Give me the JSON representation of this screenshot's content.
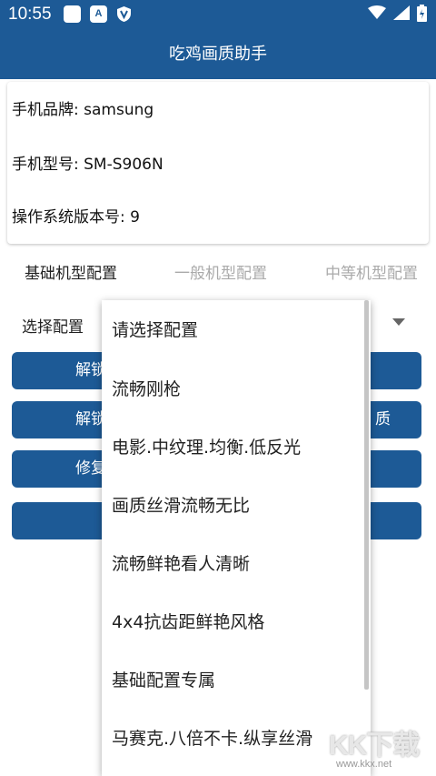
{
  "status_bar": {
    "time": "10:55",
    "icons": [
      "square-notification-icon",
      "a-notification-icon",
      "shield-notification-icon",
      "wifi-icon",
      "signal-icon",
      "battery-charging-icon"
    ],
    "a_icon_label": "A"
  },
  "app": {
    "title": "吃鸡画质助手"
  },
  "device_info": {
    "brand": "手机品牌: samsung",
    "model": "手机型号: SM-S906N",
    "os_version": "操作系统版本号: 9"
  },
  "tabs": [
    {
      "label": "基础机型配置",
      "active": true
    },
    {
      "label": "一般机型配置",
      "active": false
    },
    {
      "label": "中等机型配置",
      "active": false
    }
  ],
  "config_select": {
    "label": "选择配置"
  },
  "buttons": [
    {
      "label_visible": "解锁"
    },
    {
      "label_visible": "解锁",
      "label_tail_visible": "质"
    },
    {
      "label_visible": "修复"
    },
    {
      "label_visible": ""
    }
  ],
  "dropdown": {
    "options": [
      "请选择配置",
      "流畅刚枪",
      "电影.中纹理.均衡.低反光",
      "画质丝滑流畅无比",
      "流畅鲜艳看人清晰",
      "4x4抗齿距鲜艳风格",
      "基础配置专属",
      "马赛克.八倍不卡.纵享丝滑"
    ]
  },
  "watermark": {
    "main": "KK下载",
    "sub": "www.kkx.net"
  },
  "colors": {
    "primary": "#1d5a96",
    "text": "#222222",
    "inactive_tab": "#aaaaaa"
  }
}
